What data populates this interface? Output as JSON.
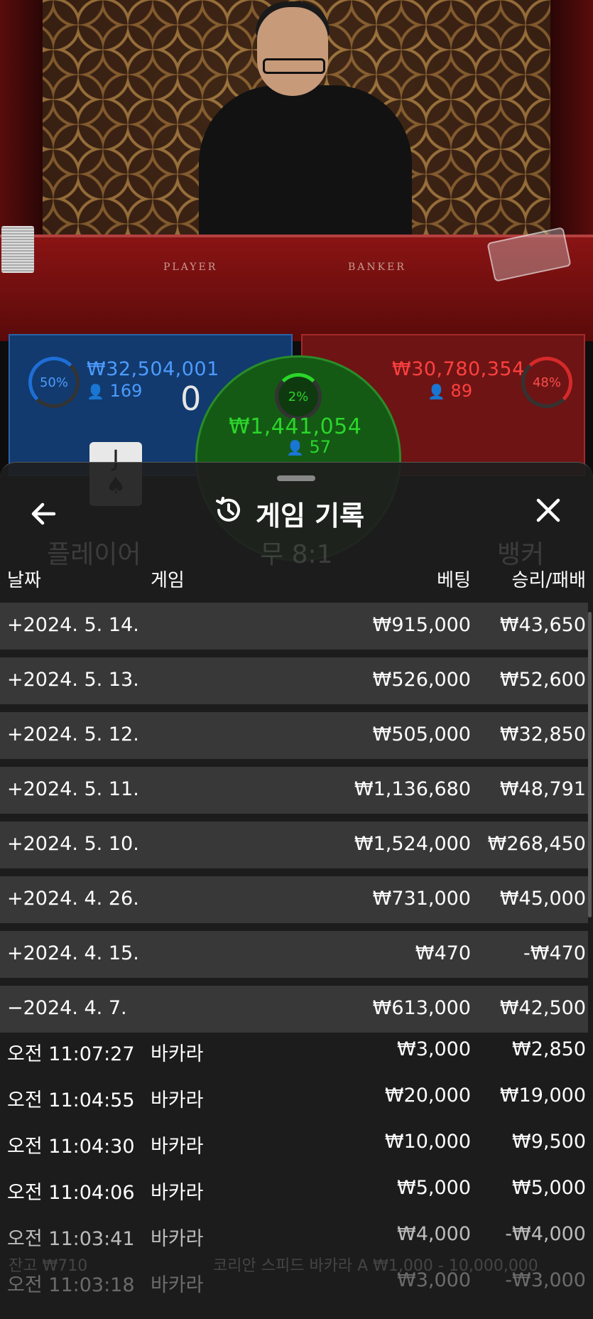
{
  "video": {
    "felt_player": "PLAYER",
    "felt_banker": "BANKER"
  },
  "bet_panel": {
    "player": {
      "percent": "50%",
      "amount": "₩32,504,001",
      "count": "169",
      "score": "0",
      "card": "J"
    },
    "tie": {
      "percent": "2%",
      "amount": "₩1,441,054",
      "count": "57"
    },
    "banker": {
      "percent": "48%",
      "amount": "₩30,780,354",
      "count": "89"
    },
    "colors": {
      "player": "#123a6e",
      "banker": "#6e1414",
      "tie": "#145a14"
    }
  },
  "sheet": {
    "title": "게임 기록",
    "icons": {
      "back": "arrow-left-icon",
      "history": "history-clock-icon",
      "close": "close-icon"
    },
    "columns": {
      "date": "날짜",
      "game": "게임",
      "bet": "베팅",
      "win_loss": "승리/패배"
    },
    "day_rows": [
      {
        "date": "+2024. 5. 14.",
        "bet": "₩915,000",
        "result": "₩43,650"
      },
      {
        "date": "+2024. 5. 13.",
        "bet": "₩526,000",
        "result": "₩52,600"
      },
      {
        "date": "+2024. 5. 12.",
        "bet": "₩505,000",
        "result": "₩32,850"
      },
      {
        "date": "+2024. 5. 11.",
        "bet": "₩1,136,680",
        "result": "₩48,791"
      },
      {
        "date": "+2024. 5. 10.",
        "bet": "₩1,524,000",
        "result": "₩268,450"
      },
      {
        "date": "+2024. 4. 26.",
        "bet": "₩731,000",
        "result": "₩45,000"
      },
      {
        "date": "+2024. 4. 15.",
        "bet": "₩470",
        "result": "-₩470"
      },
      {
        "date": "−2024. 4. 7.",
        "bet": "₩613,000",
        "result": "₩42,500"
      }
    ],
    "game_rows": [
      {
        "time": "오전 11:07:27",
        "game": "바카라",
        "bet": "₩3,000",
        "result": "₩2,850"
      },
      {
        "time": "오전 11:04:55",
        "game": "바카라",
        "bet": "₩20,000",
        "result": "₩19,000"
      },
      {
        "time": "오전 11:04:30",
        "game": "바카라",
        "bet": "₩10,000",
        "result": "₩9,500"
      },
      {
        "time": "오전 11:04:06",
        "game": "바카라",
        "bet": "₩5,000",
        "result": "₩5,000"
      },
      {
        "time": "오전 11:03:41",
        "game": "바카라",
        "bet": "₩4,000",
        "result": "-₩4,000"
      },
      {
        "time": "오전 11:03:18",
        "game": "바카라",
        "bet": "₩3,000",
        "result": "-₩3,000"
      }
    ]
  },
  "background_ghost": {
    "player_label": "플레이어",
    "tie_label": "무 8:1",
    "banker_label": "뱅커",
    "balance": "잔고 ₩710",
    "table_info": "코리안 스피드 바카라 A ₩1,000 - 10,000,000"
  }
}
